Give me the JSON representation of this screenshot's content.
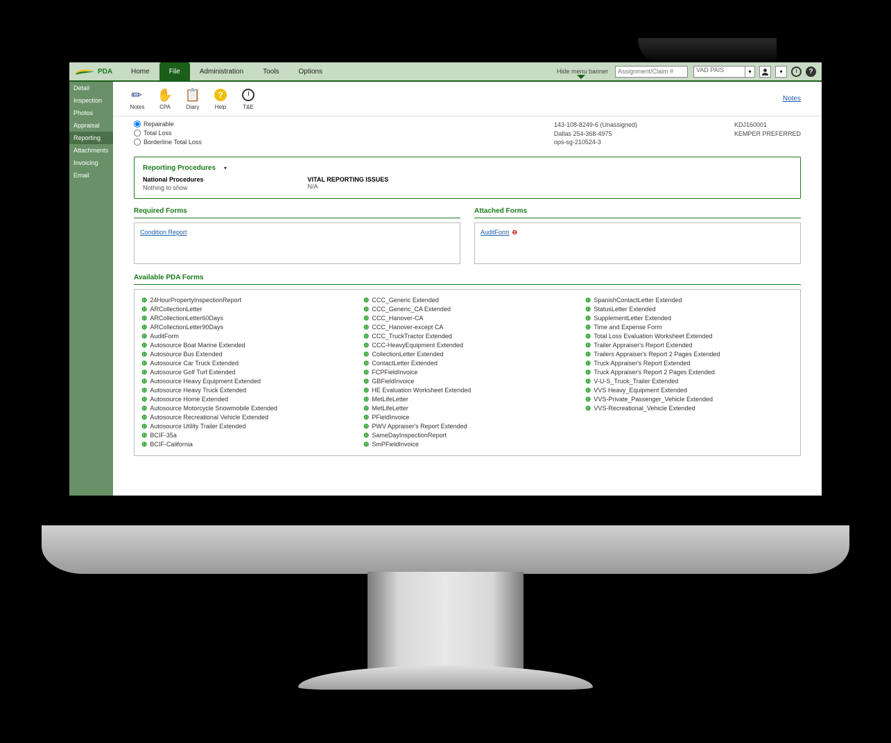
{
  "brand": "PDA",
  "nav": {
    "items": [
      "Home",
      "File",
      "Administration",
      "Tools",
      "Options"
    ],
    "active": 1,
    "hide_banner": "Hide menu banner",
    "search_placeholder": "Assignment/Claim #"
  },
  "topright": {
    "dropdown_value": "VAD PAIS",
    "user_icon": "user",
    "help_char": "?"
  },
  "sidebar": {
    "items": [
      "Detail",
      "Inspection",
      "Photos",
      "Appraisal",
      "Reporting",
      "Attachments",
      "Invoicing",
      "Email"
    ],
    "active": 4
  },
  "toolbar": {
    "tools": [
      {
        "label": "Notes",
        "icon": "pencil"
      },
      {
        "label": "CPA",
        "icon": "hand"
      },
      {
        "label": "Diary",
        "icon": "clip"
      },
      {
        "label": "Help",
        "icon": "q"
      },
      {
        "label": "T&E",
        "icon": "clock"
      }
    ],
    "notes_link": "Notes"
  },
  "radios": {
    "options": [
      "Repairable",
      "Total Loss",
      "Borderline Total Loss"
    ],
    "selected": 0
  },
  "info1": {
    "line1": "143-108-8249-6 (Unassigned)",
    "line2": "Dallas 254-368-4975",
    "line3": "ops-sg-210524-3"
  },
  "info2": {
    "line1": "KDJ160001",
    "line2": "KEMPER PREFERRED"
  },
  "procedures": {
    "title": "Reporting Procedures",
    "col1_label": "National Procedures",
    "col1_value": "Nothing to show",
    "col2_label": "VITAL REPORTING ISSUES",
    "col2_value": "N/A"
  },
  "required_forms": {
    "title": "Required Forms",
    "items": [
      "Condition Report"
    ]
  },
  "attached_forms": {
    "title": "Attached Forms",
    "items": [
      {
        "name": "AuditForm"
      }
    ]
  },
  "available": {
    "title": "Available PDA Forms",
    "col1": [
      "24HourPropertyInspectionReport",
      "ARCollectionLetter",
      "ARCollectionLetter60Days",
      "ARCollectionLetter90Days",
      "AuditForm",
      "Autosource Boat Marine Extended",
      "Autosource Bus Extended",
      "Autosource Car Truck Extended",
      "Autosource Golf Turf Extended",
      "Autosource Heavy Equipment Extended",
      "Autosource Heavy Truck Extended",
      "Autosource Home Extended",
      "Autosource Motorcycle Snowmobile Extended",
      "Autosource Recreational Vehicle Extended",
      "Autosource Utility Trailer Extended",
      "BCIF-35a",
      "BCIF-California"
    ],
    "col2": [
      "CCC_Generic Extended",
      "CCC_Generic_CA Extended",
      "CCC_Hanover-CA",
      "CCC_Hanover-except CA",
      "CCC_TruckTractor Extended",
      "CCC-HeavyEquipment Extended",
      "CollectionLetter Extended",
      "ContactLetter Extended",
      "FCPFieldInvoice",
      "GBFieldInvoice",
      "HE Evaluation Worksheet Extended",
      "MetLifeLetter",
      "MetLifeLetter",
      "PFieldInvoice",
      "PWV Appraiser's Report Extended",
      "SameDayInspectionReport",
      "SmPFieldInvoice"
    ],
    "col3": [
      "SpanishContactLetter Extended",
      "StatusLetter Extended",
      "SupplementLetter Extended",
      "Time and Expense Form",
      "Total Loss Evaluation Worksheet Extended",
      "Trailer Appraiser's Report Extended",
      "Trailers Appraiser's Report 2 Pages Extended",
      "Truck Appraiser's Report Extended",
      "Truck Appraiser's Report 2 Pages Extended",
      "V-U-S_Truck_Trailer Extended",
      "VVS Heavy_Equipment Extended",
      "VVS-Private_Passenger_Vehicle Extended",
      "VVS-Recreational_Vehicle Extended"
    ]
  }
}
